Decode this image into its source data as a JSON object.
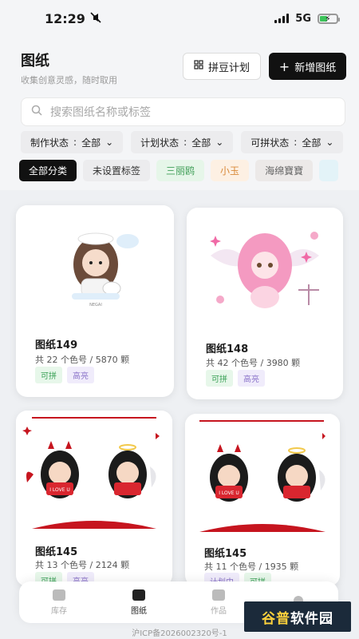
{
  "status_bar": {
    "time": "12:29",
    "network": "5G"
  },
  "header": {
    "title": "图纸",
    "subtitle": "收集创意灵感，随时取用",
    "plan_button": "拼豆计划",
    "new_button": "新增图纸"
  },
  "search": {
    "placeholder": "搜索图纸名称或标签"
  },
  "filters": [
    {
      "label": "制作状态",
      "value": "全部"
    },
    {
      "label": "计划状态",
      "value": "全部"
    },
    {
      "label": "可拼状态",
      "value": "全部"
    }
  ],
  "tags": [
    "全部分类",
    "未设置标签",
    "三丽鸥",
    "小玉",
    "海绵寶寶"
  ],
  "cards": [
    {
      "title": "图纸149",
      "meta": "共 22 个色号 / 5870 颗",
      "chips": [
        "可拼",
        "高亮"
      ],
      "art_caption": "NEGAI"
    },
    {
      "title": "图纸148",
      "meta": "共 42 个色号 / 3980 颗",
      "chips": [
        "可拼",
        "高亮"
      ]
    },
    {
      "title": "图纸145",
      "meta": "共 13 个色号 / 2124 颗",
      "chips": [
        "可拼",
        "高亮"
      ],
      "art_text": "I LOVE U"
    },
    {
      "title": "图纸145",
      "meta": "共 11 个色号 / 1935 颗",
      "chips": [
        "计划中",
        "可拼"
      ],
      "art_text": "I LOVE U"
    }
  ],
  "tabbar": [
    {
      "label": "库存",
      "icon": "inventory-icon"
    },
    {
      "label": "图纸",
      "icon": "pattern-icon"
    },
    {
      "label": "作品",
      "icon": "image-icon"
    },
    {
      "label": "",
      "icon": "user-icon"
    }
  ],
  "icp": "沪ICP备2026002320号-1",
  "watermark": {
    "part1": "谷普",
    "part2": "软件园"
  },
  "colors": {
    "primary": "#111111",
    "accent_green": "#3aa156",
    "accent_purple": "#8a73c9"
  }
}
